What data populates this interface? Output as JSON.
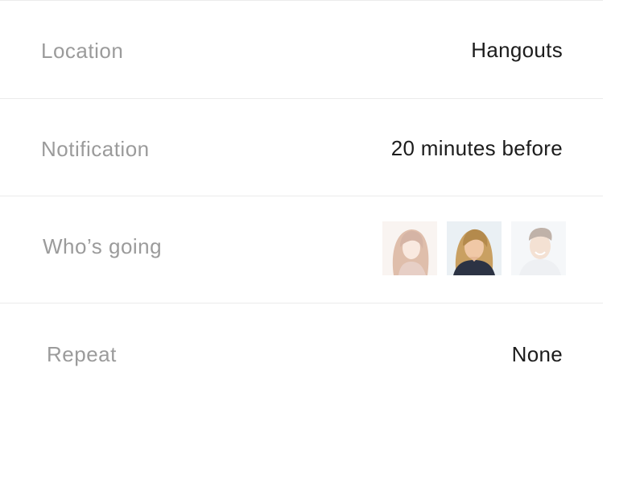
{
  "rows": [
    {
      "label": "Location",
      "value": "Hangouts"
    },
    {
      "label": "Notification",
      "value": "20 minutes before"
    },
    {
      "label": "Who’s going",
      "value": ""
    },
    {
      "label": "Repeat",
      "value": "None"
    }
  ],
  "attendees": [
    {
      "name": "avatar-woman-redhair",
      "faded": true
    },
    {
      "name": "avatar-woman-blonde",
      "faded": false
    },
    {
      "name": "avatar-man-smiling",
      "faded": true
    }
  ],
  "colors": {
    "label": "#9b9b9b",
    "value": "#1c1c1c",
    "divider": "#ebebeb",
    "background": "#ffffff"
  }
}
